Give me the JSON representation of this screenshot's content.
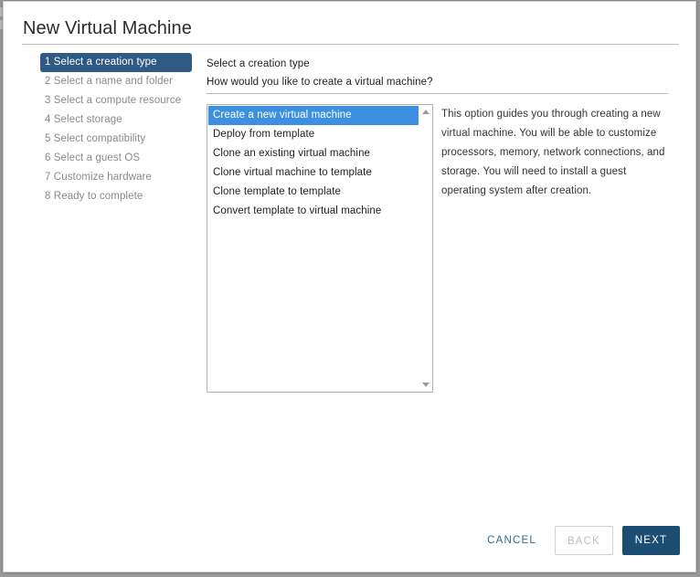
{
  "dialog": {
    "title": "New Virtual Machine"
  },
  "steps": [
    {
      "label": "1 Select a creation type",
      "state": "active"
    },
    {
      "label": "2 Select a name and folder",
      "state": "pending"
    },
    {
      "label": "3 Select a compute resource",
      "state": "pending"
    },
    {
      "label": "4 Select storage",
      "state": "pending"
    },
    {
      "label": "5 Select compatibility",
      "state": "pending"
    },
    {
      "label": "6 Select a guest OS",
      "state": "pending"
    },
    {
      "label": "7 Customize hardware",
      "state": "pending"
    },
    {
      "label": "8 Ready to complete",
      "state": "pending"
    }
  ],
  "main": {
    "section_title": "Select a creation type",
    "section_subtitle": "How would you like to create a virtual machine?",
    "creation_types": [
      {
        "label": "Create a new virtual machine",
        "selected": true
      },
      {
        "label": "Deploy from template",
        "selected": false
      },
      {
        "label": "Clone an existing virtual machine",
        "selected": false
      },
      {
        "label": "Clone virtual machine to template",
        "selected": false
      },
      {
        "label": "Clone template to template",
        "selected": false
      },
      {
        "label": "Convert template to virtual machine",
        "selected": false
      }
    ],
    "description": "This option guides you through creating a new virtual machine. You will be able to customize processors, memory, network connections, and storage. You will need to install a guest operating system after creation."
  },
  "footer": {
    "cancel_label": "CANCEL",
    "back_label": "BACK",
    "back_enabled": false,
    "next_label": "NEXT"
  },
  "colors": {
    "active_step_bg": "#2e5a84",
    "selected_option_bg": "#3d8fe0",
    "next_button_bg": "#1c4d72",
    "cancel_text": "#2d6a96"
  }
}
